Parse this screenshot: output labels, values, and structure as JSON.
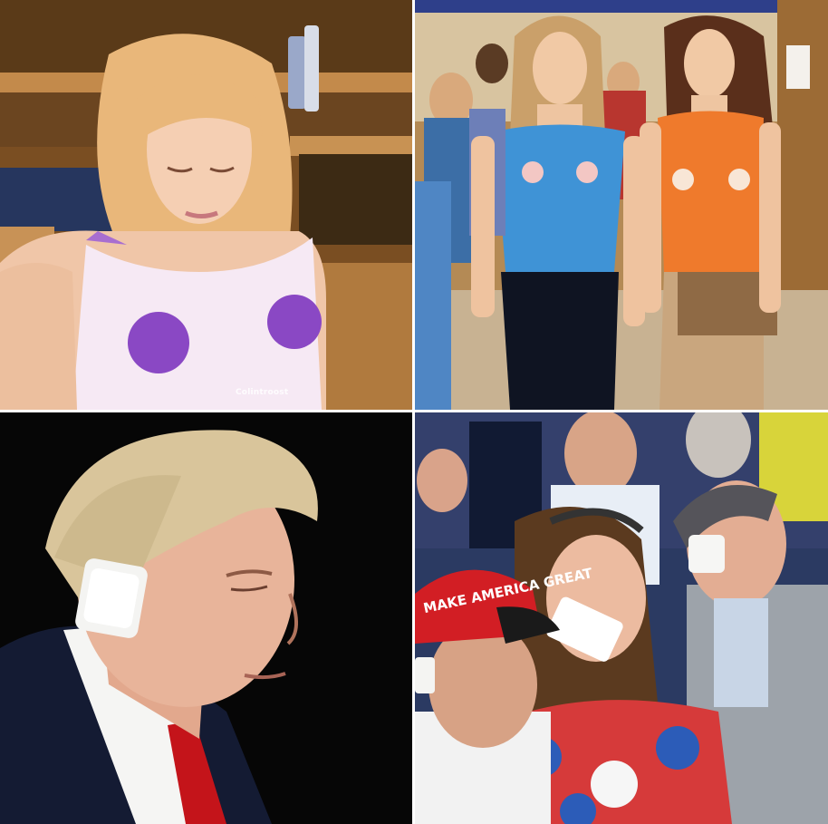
{
  "watermark": "Colintroost",
  "cap_text": "MAKE AMERICA GREAT"
}
